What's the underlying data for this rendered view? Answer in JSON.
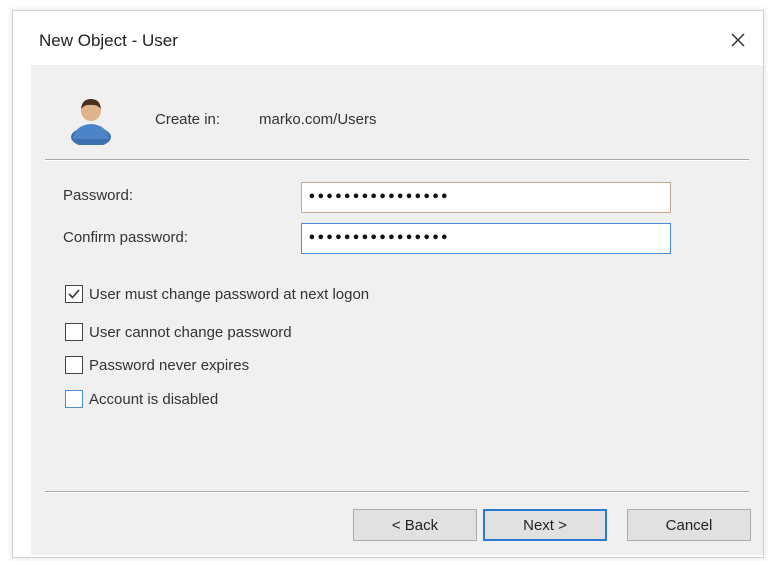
{
  "window": {
    "title": "New Object - User"
  },
  "header": {
    "create_label": "Create in:",
    "create_value": "marko.com/Users"
  },
  "fields": {
    "password_label": "Password:",
    "password_value": "••••••••••••••••",
    "confirm_label": "Confirm password:",
    "confirm_value": "••••••••••••••••"
  },
  "options": [
    {
      "label": "User must change password at next logon",
      "checked": true
    },
    {
      "label": "User cannot change password",
      "checked": false
    },
    {
      "label": "Password never expires",
      "checked": false
    },
    {
      "label": "Account is disabled",
      "checked": false
    }
  ],
  "buttons": {
    "back": "< Back",
    "next": "Next >",
    "cancel": "Cancel"
  },
  "icons": {
    "close": "close-icon",
    "user": "user-icon",
    "check": "checkmark-icon"
  },
  "colors": {
    "dialog_background": "#f0f0f0",
    "focus_border": "#2a7ad4"
  }
}
